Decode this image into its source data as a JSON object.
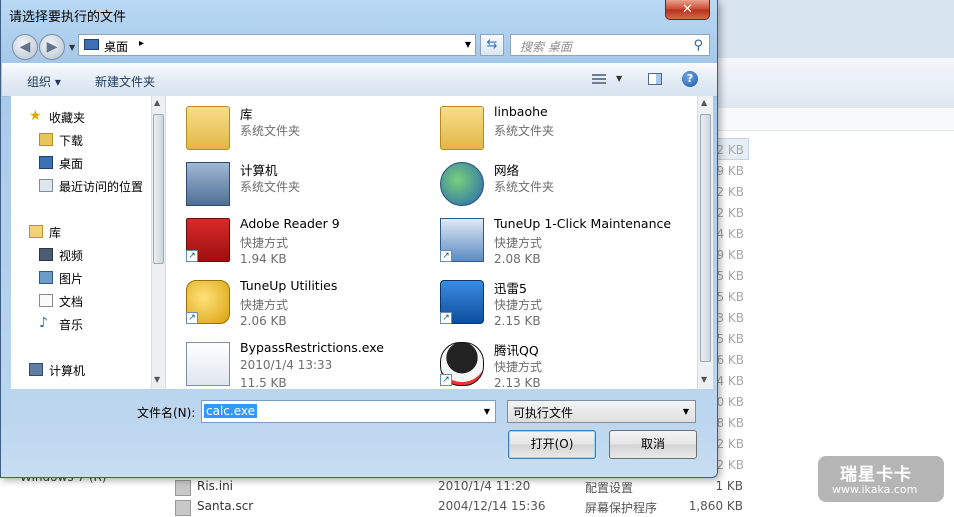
{
  "dialog": {
    "title": "请选择要执行的文件",
    "close_label": "✕",
    "address": {
      "location": "桌面",
      "separator": "▸"
    },
    "search_placeholder": "搜索 桌面",
    "toolbar": {
      "organize": "组织 ▾",
      "new_folder": "新建文件夹",
      "help": "?"
    },
    "nav": {
      "favorites_label": "收藏夹",
      "favorites": [
        "下载",
        "桌面",
        "最近访问的位置"
      ],
      "libraries_label": "库",
      "libraries": [
        "视频",
        "图片",
        "文档",
        "音乐"
      ],
      "computer_label": "计算机"
    },
    "files": [
      {
        "name": "库",
        "line1": "系统文件夹",
        "line2": "",
        "icon": "library-folder-icon",
        "shortcut": false
      },
      {
        "name": "linbaohe",
        "line1": "系统文件夹",
        "line2": "",
        "icon": "user-folder-icon",
        "shortcut": false
      },
      {
        "name": "计算机",
        "line1": "系统文件夹",
        "line2": "",
        "icon": "computer-icon",
        "shortcut": false
      },
      {
        "name": "网络",
        "line1": "系统文件夹",
        "line2": "",
        "icon": "network-globe-icon",
        "shortcut": false
      },
      {
        "name": "Adobe Reader 9",
        "line1": "快捷方式",
        "line2": "1.94 KB",
        "icon": "adobe-reader-icon",
        "shortcut": true
      },
      {
        "name": "TuneUp 1-Click Maintenance",
        "line1": "快捷方式",
        "line2": "2.08 KB",
        "icon": "tuneup-maintenance-icon",
        "shortcut": true
      },
      {
        "name": "TuneUp Utilities",
        "line1": "快捷方式",
        "line2": "2.06 KB",
        "icon": "tuneup-utilities-icon",
        "shortcut": true
      },
      {
        "name": "迅雷5",
        "line1": "快捷方式",
        "line2": "2.15 KB",
        "icon": "thunder-icon",
        "shortcut": true
      },
      {
        "name": "BypassRestrictions.exe",
        "line1": "2010/1/4 13:33",
        "line2": "11.5 KB",
        "icon": "exe-window-icon",
        "shortcut": false
      },
      {
        "name": "腾讯QQ",
        "line1": "快捷方式",
        "line2": "2.13 KB",
        "icon": "qq-penguin-icon",
        "shortcut": true
      }
    ],
    "filename_label": "文件名(N):",
    "filename_value": "calc.exe",
    "filetype_value": "可执行文件",
    "open_button": "打开(O)",
    "cancel_button": "取消"
  },
  "background": {
    "sizes": [
      "2 KB",
      "9 KB",
      "2 KB",
      "2 KB",
      "4 KB",
      "9 KB",
      "5 KB",
      "5 KB",
      "3 KB",
      "5 KB",
      "6 KB",
      "4 KB",
      "0 KB",
      "8 KB",
      "2 KB",
      "2 KB"
    ],
    "rows": [
      {
        "name": "Ris.ini",
        "date": "2010/1/4 11:20",
        "type": "配置设置",
        "size": "1 KB"
      },
      {
        "name": "Santa.scr",
        "date": "2004/12/14 15:36",
        "type": "屏幕保护程序",
        "size": "1,860 KB"
      }
    ],
    "left_item": "Windows 7 (R)"
  },
  "watermark": {
    "title": "瑞星卡卡",
    "url": "www.ikaka.com"
  }
}
